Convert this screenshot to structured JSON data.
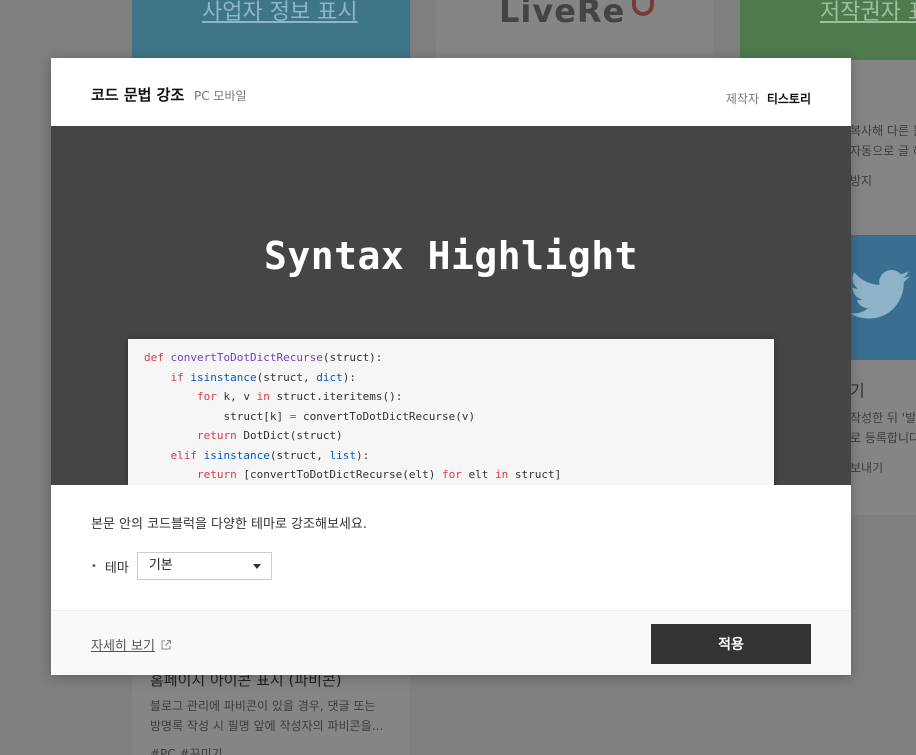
{
  "background": {
    "card_left_title": "사업자 정보 표시",
    "card_mid_logo": "LiveRe",
    "card_right_title": "저작권자 표시",
    "card_right_line1": "복사해 다른 블",
    "card_right_line2": "자동으로 글 하",
    "card_right_tag": "방지",
    "twitter_title": "기",
    "twitter_line1": "작성한 뒤 '발행",
    "twitter_line2": "로 등록합니다",
    "twitter_tag": "보내기",
    "favicon_title": "홈페이지 아이콘 표시 (파비콘)",
    "favicon_line1": "블로그 관리에 파비콘이 있을 경우, 댓글 또는",
    "favicon_line2": "방명록 작성 시 필명 앞에 작성자의 파비콘을…",
    "favicon_tags": "#PC  #꾸미기"
  },
  "modal": {
    "title": "코드 문법 강조",
    "subtitle": "PC 모바일",
    "maker_label": "제작자",
    "maker_name": "티스토리",
    "preview_title": "Syntax Highlight",
    "description": "본문 안의 코드블럭을 다양한 테마로 강조해보세요.",
    "theme_label": "테마",
    "theme_selected": "기본",
    "detail_link": "자세히 보기",
    "apply_label": "적용"
  },
  "code_lines": [
    [
      {
        "t": "def ",
        "c": "kw"
      },
      {
        "t": "convertToDotDictRecurse",
        "c": "fn"
      },
      {
        "t": "(struct):",
        "c": ""
      }
    ],
    [
      {
        "t": "    ",
        "c": ""
      },
      {
        "t": "if ",
        "c": "kw"
      },
      {
        "t": "isinstance",
        "c": "bi"
      },
      {
        "t": "(struct, ",
        "c": ""
      },
      {
        "t": "dict",
        "c": "bi"
      },
      {
        "t": "):",
        "c": ""
      }
    ],
    [
      {
        "t": "        ",
        "c": ""
      },
      {
        "t": "for ",
        "c": "kw"
      },
      {
        "t": "k, v ",
        "c": ""
      },
      {
        "t": "in ",
        "c": "kw"
      },
      {
        "t": "struct.iteritems():",
        "c": ""
      }
    ],
    [
      {
        "t": "            struct[k] ",
        "c": ""
      },
      {
        "t": "= ",
        "c": "kw"
      },
      {
        "t": "convertToDotDictRecurse(v)",
        "c": ""
      }
    ],
    [
      {
        "t": "        ",
        "c": ""
      },
      {
        "t": "return ",
        "c": "kw"
      },
      {
        "t": "DotDict(struct)",
        "c": ""
      }
    ],
    [
      {
        "t": "    ",
        "c": ""
      },
      {
        "t": "elif ",
        "c": "kw"
      },
      {
        "t": "isinstance",
        "c": "bi"
      },
      {
        "t": "(struct, ",
        "c": ""
      },
      {
        "t": "list",
        "c": "bi"
      },
      {
        "t": "):",
        "c": ""
      }
    ],
    [
      {
        "t": "        ",
        "c": ""
      },
      {
        "t": "return ",
        "c": "kw"
      },
      {
        "t": "[convertToDotDictRecurse(elt) ",
        "c": ""
      },
      {
        "t": "for ",
        "c": "kw"
      },
      {
        "t": "elt ",
        "c": ""
      },
      {
        "t": "in ",
        "c": "kw"
      },
      {
        "t": "struct]",
        "c": ""
      }
    ]
  ],
  "colors": {
    "overlay": "#7f7f7f",
    "preview_bg": "#454545",
    "apply_bg": "#333333",
    "keyword": "#d73a49",
    "function": "#6f42c1",
    "builtin": "#005cc5"
  }
}
